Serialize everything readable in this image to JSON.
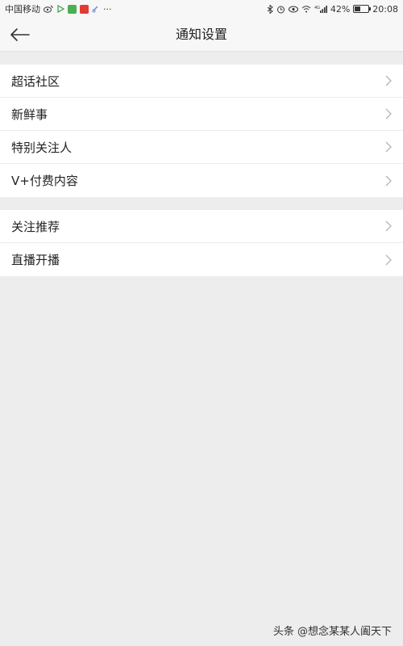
{
  "status_bar": {
    "carrier": "中国移动",
    "more": "···",
    "signal_label": "4G",
    "battery_percent": "42%",
    "battery_level": 0.42,
    "time": "20:08"
  },
  "header": {
    "title": "通知设置",
    "back_icon": "arrow-left-icon"
  },
  "groups": [
    {
      "items": [
        {
          "label": "超话社区"
        },
        {
          "label": "新鲜事"
        },
        {
          "label": "特别关注人"
        },
        {
          "label": "V+付费内容"
        }
      ]
    },
    {
      "items": [
        {
          "label": "关注推荐"
        },
        {
          "label": "直播开播"
        }
      ]
    }
  ],
  "watermark": "头条 @想念某某人阖天下",
  "colors": {
    "background": "#ededed",
    "card": "#ffffff",
    "chevron": "#b5b5b5"
  }
}
